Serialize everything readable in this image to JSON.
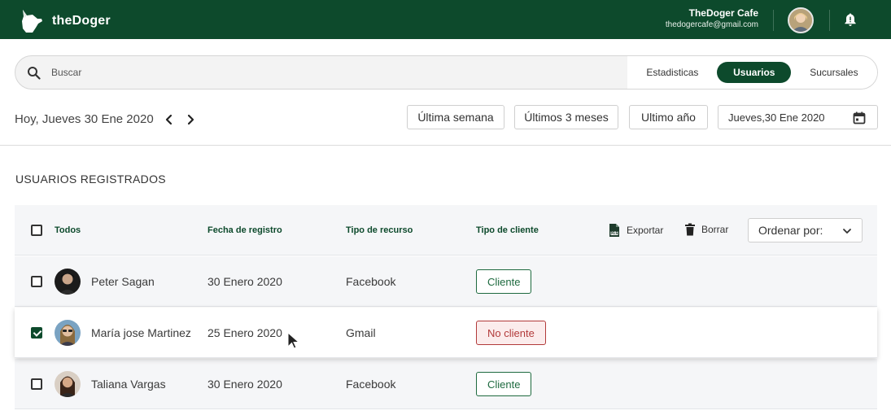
{
  "brand": {
    "name": "theDoger"
  },
  "account": {
    "name": "TheDoger Cafe",
    "email": "thedogercafe@gmail.com"
  },
  "search": {
    "placeholder": "Buscar"
  },
  "tabs": [
    {
      "label": "Estadisticas",
      "active": false
    },
    {
      "label": "Usuarios",
      "active": true
    },
    {
      "label": "Sucursales",
      "active": false
    }
  ],
  "date_nav": {
    "today": "Hoy, Jueves 30 Ene 2020"
  },
  "ranges": [
    "Última semana",
    "Últimos 3 meses",
    "Ultimo año"
  ],
  "date_picker": {
    "value": "Jueves,30 Ene 2020"
  },
  "section": {
    "title": "USUARIOS REGISTRADOS"
  },
  "table": {
    "headers": {
      "all": "Todos",
      "date": "Fecha de registro",
      "resource": "Tipo de recurso",
      "client": "Tipo de cliente"
    },
    "actions": {
      "export": "Exportar",
      "delete": "Borrar"
    },
    "sort": {
      "label": "Ordenar por:"
    },
    "rows": [
      {
        "name": "Peter Sagan",
        "date": "30 Enero 2020",
        "resource": "Facebook",
        "client": "Cliente",
        "checked": false
      },
      {
        "name": "María jose Martinez",
        "date": "25 Enero 2020",
        "resource": "Gmail",
        "client": "No cliente",
        "checked": true
      },
      {
        "name": "Taliana Vargas",
        "date": "30 Enero 2020",
        "resource": "Facebook",
        "client": "Cliente",
        "checked": false
      }
    ]
  },
  "colors": {
    "primary": "#0d4a2c",
    "cliente": "#1e6a3f",
    "no_cliente": "#b23a3a"
  }
}
